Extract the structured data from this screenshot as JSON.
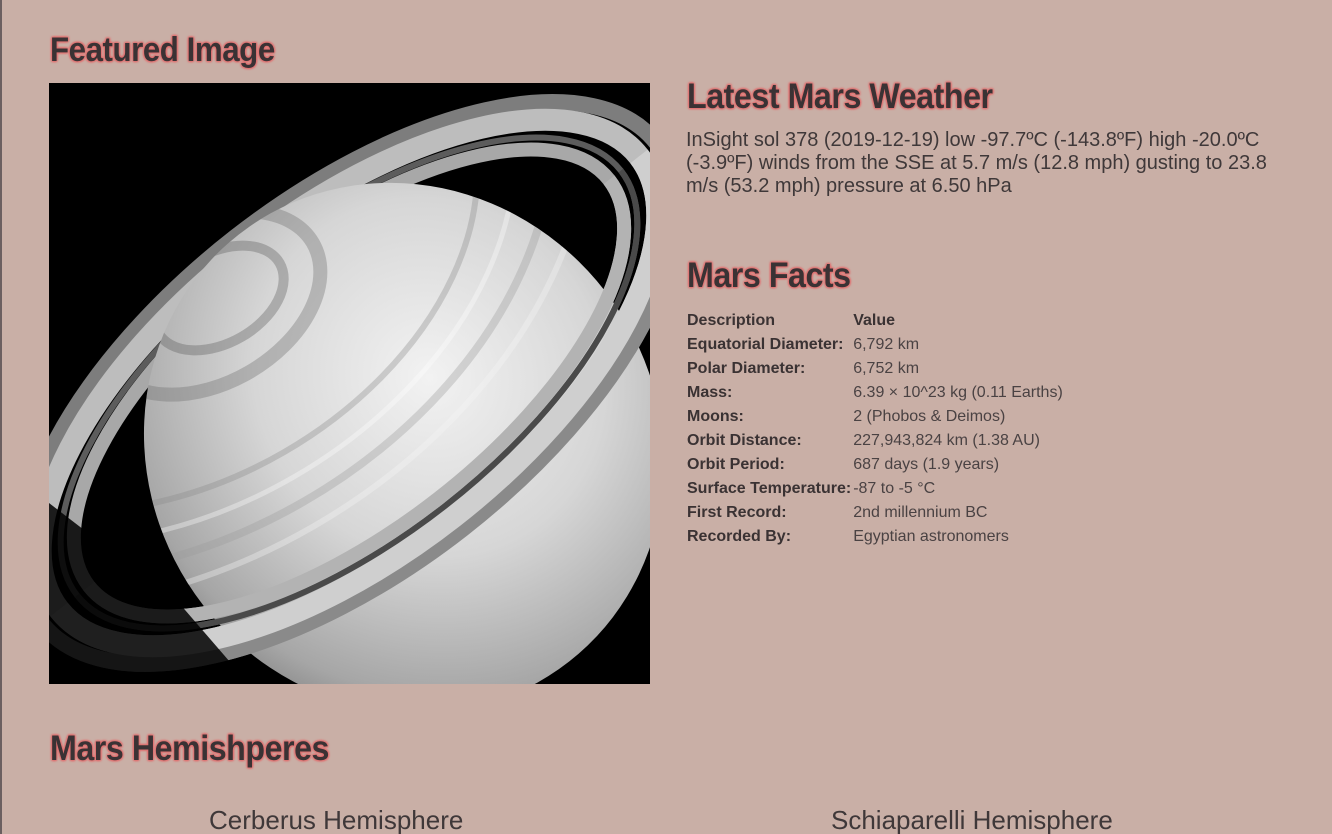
{
  "featured": {
    "title": "Featured Image"
  },
  "weather": {
    "title": "Latest Mars Weather",
    "text": "InSight sol 378 (2019-12-19) low -97.7ºC (-143.8ºF) high -20.0ºC (-3.9ºF) winds from the SSE at 5.7 m/s (12.8 mph) gusting to 23.8 m/s (53.2 mph) pressure at 6.50 hPa"
  },
  "facts": {
    "title": "Mars Facts",
    "header": {
      "description": "Description",
      "value": "Value"
    },
    "rows": [
      {
        "label": "Equatorial Diameter:",
        "value": "6,792 km"
      },
      {
        "label": "Polar Diameter:",
        "value": "6,752 km"
      },
      {
        "label": "Mass:",
        "value": "6.39 × 10^23 kg (0.11 Earths)"
      },
      {
        "label": "Moons:",
        "value": "2 (Phobos & Deimos)"
      },
      {
        "label": "Orbit Distance:",
        "value": "227,943,824 km (1.38 AU)"
      },
      {
        "label": "Orbit Period:",
        "value": "687 days (1.9 years)"
      },
      {
        "label": "Surface Temperature:",
        "value": "-87 to -5 °C"
      },
      {
        "label": "First Record:",
        "value": "2nd millennium BC"
      },
      {
        "label": "Recorded By:",
        "value": "Egyptian astronomers"
      }
    ]
  },
  "hemispheres": {
    "title": "Mars Hemishperes",
    "items": [
      {
        "name": "Cerberus Hemisphere"
      },
      {
        "name": "Schiaparelli Hemisphere"
      }
    ]
  }
}
